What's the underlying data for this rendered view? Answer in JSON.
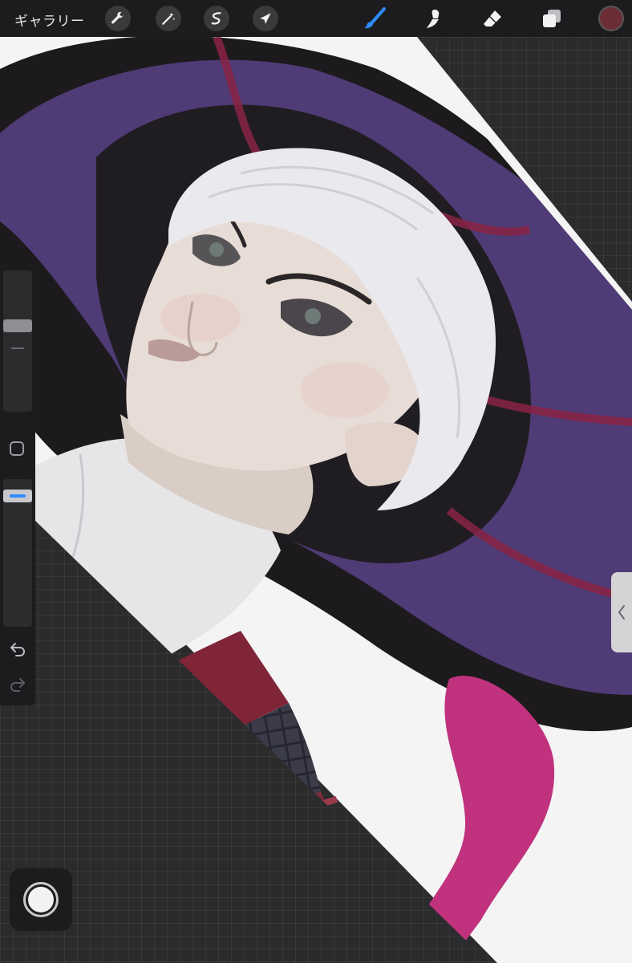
{
  "toolbar": {
    "gallery_label": "ギャラリー",
    "left_tools": [
      "wrench-icon",
      "magic-wand-icon",
      "selection-icon",
      "transform-arrow-icon"
    ],
    "right_tools": [
      "brush-icon",
      "smudge-icon",
      "eraser-icon",
      "layers-icon"
    ],
    "active_tool": "brush-icon",
    "current_color": "#6b2d36",
    "accent_color": "#2f8cff"
  },
  "sidebar": {
    "brush_size_level": 0.62,
    "opacity_level": 0.92,
    "undo_icon": "undo-icon",
    "redo_icon": "redo-icon"
  },
  "canvas": {
    "subject": "illustration",
    "palette": {
      "paper": "#f4f4f5",
      "hat_purple": "#4f3a74",
      "hat_black": "#1a1819",
      "trim_red": "#7a1f35",
      "skin": "#e8ddd6",
      "hair": "#e9e9ee",
      "coat_red": "#7c2d3a",
      "mesh_dark": "#3a3a45",
      "ribbon_pink": "#c0327d"
    }
  }
}
